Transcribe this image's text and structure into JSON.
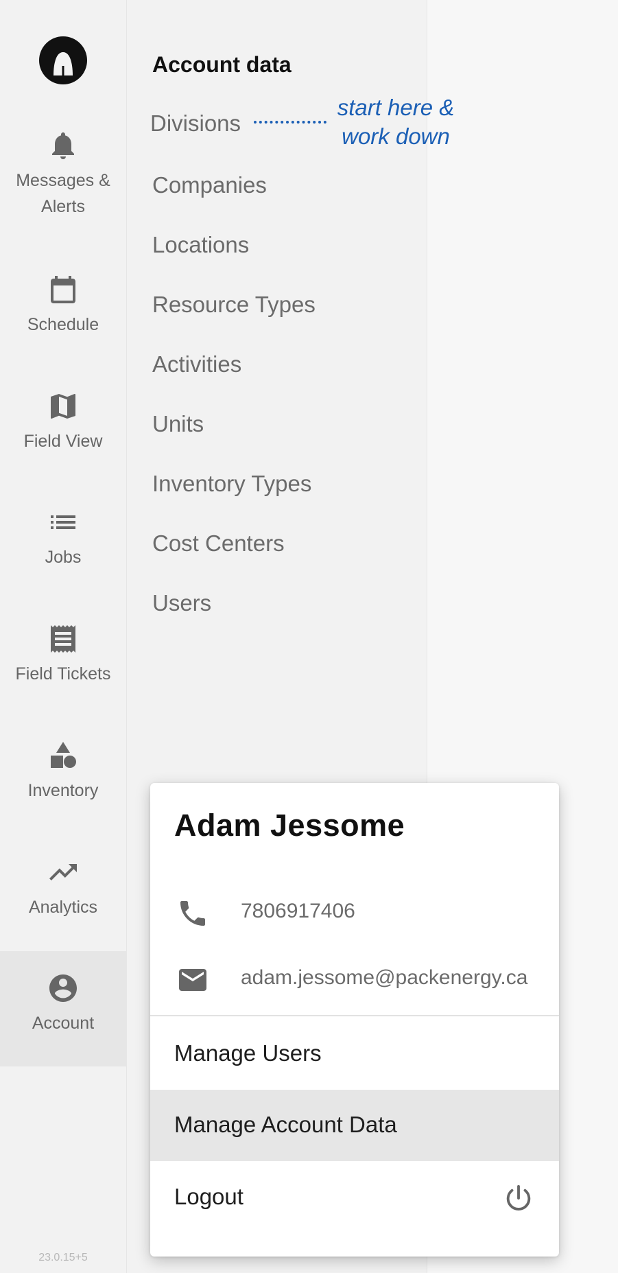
{
  "rail": {
    "items": [
      {
        "label": "Messages & Alerts",
        "icon": "bell-icon"
      },
      {
        "label": "Schedule",
        "icon": "calendar-icon"
      },
      {
        "label": "Field View",
        "icon": "map-icon"
      },
      {
        "label": "Jobs",
        "icon": "list-icon"
      },
      {
        "label": "Field Tickets",
        "icon": "receipt-icon"
      },
      {
        "label": "Inventory",
        "icon": "shapes-icon"
      },
      {
        "label": "Analytics",
        "icon": "trending-up-icon"
      },
      {
        "label": "Account",
        "icon": "account-circle-icon",
        "active": true
      }
    ],
    "version": "23.0.15+5"
  },
  "account_panel": {
    "title": "Account data",
    "items": [
      "Divisions",
      "Companies",
      "Locations",
      "Resource Types",
      "Activities",
      "Units",
      "Inventory Types",
      "Cost Centers",
      "Users"
    ],
    "annotation": "start here & work down"
  },
  "profile_card": {
    "name": "Adam Jessome",
    "phone": "7806917406",
    "email": "adam.jessome@packenergy.ca",
    "menu": [
      {
        "label": "Manage Users"
      },
      {
        "label": "Manage Account Data",
        "highlighted": true
      },
      {
        "label": "Logout",
        "icon": "power-icon"
      }
    ]
  },
  "colors": {
    "annotation_blue": "#1b5fb5",
    "rail_bg": "#f2f2f2",
    "active_bg": "#e6e6e6",
    "icon_gray": "#666666"
  }
}
